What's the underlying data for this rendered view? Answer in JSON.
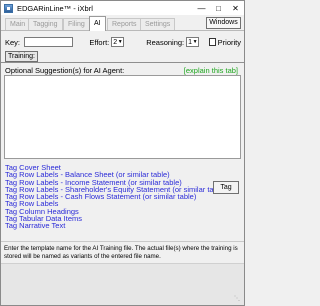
{
  "window": {
    "title": "EDGARinLine™ - iXbrl",
    "controls": [
      "minimize",
      "maximize",
      "close"
    ]
  },
  "tabs": [
    {
      "label": "Main",
      "active": false
    },
    {
      "label": "Tagging",
      "active": false
    },
    {
      "label": "Filing",
      "active": false
    },
    {
      "label": "AI",
      "active": true
    },
    {
      "label": "Reports",
      "active": false
    },
    {
      "label": "Settings",
      "active": false
    }
  ],
  "windows_button": "Windows",
  "form": {
    "key_label": "Key:",
    "key_value": "",
    "effort_label": "Effort:",
    "effort_value": "2",
    "reasoning_label": "Reasoning:",
    "reasoning_value": "1",
    "priority_label": "Priority",
    "priority_checked": false
  },
  "training_button": "Training:",
  "suggestions": {
    "label": "Optional Suggestion(s) for AI Agent:",
    "explain_link": "[explain this tab]",
    "value": ""
  },
  "tag_links": [
    "Tag Cover Sheet",
    "Tag Row Labels - Balance Sheet (or similar table)",
    "Tag Row Labels - Income Statement (or similar table)",
    "Tag Row Labels - Shareholder's Equity Statement (or similar table)",
    "Tag Row Labels - Cash Flows Statement (or similar table)",
    "Tag Row Labels",
    "Tag Column Headings",
    "Tag Tabular Data Items",
    "Tag Narrative Text"
  ],
  "tag_button": "Tag",
  "status_text": "Enter the template name for the AI Training file. The actual file(s) where the training is stored will be named as variants of the entered file name.",
  "colors": {
    "link": "#2b2bd8",
    "explain": "#1fa61f",
    "background": "#f0f0f0"
  }
}
